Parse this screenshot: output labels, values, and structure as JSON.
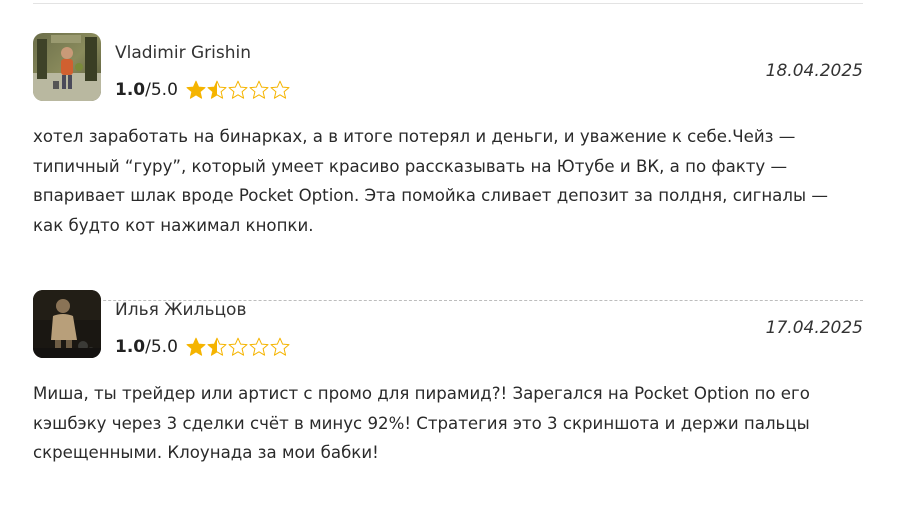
{
  "colors": {
    "star_fill": "#f5b400",
    "star_outline": "#f5b400",
    "divider": "#bdbdbd"
  },
  "reviews": [
    {
      "author": "Vladimir Grishin",
      "avatar_icon": "user-photo-avatar",
      "score": "1.0",
      "score_sep": "/",
      "score_max": "5.0",
      "rating": 1.5,
      "max_stars": 5,
      "date": "18.04.2025",
      "text": "хотел заработать на бинарках, а в итоге потерял и деньги, и уважение к себе.Чейз — типичный “гуру”, который умеет красиво рассказывать на Ютубе и ВК, а по факту — впаривает шлак вроде Pocket Option. Эта помойка сливает депозит за полдня, сигналы — как будто кот нажимал кнопки."
    },
    {
      "author": "Илья Жильцов",
      "avatar_icon": "user-photo-avatar",
      "score": "1.0",
      "score_sep": "/",
      "score_max": "5.0",
      "rating": 1.5,
      "max_stars": 5,
      "date": "17.04.2025",
      "text": "Миша, ты трейдер или артист с промо для пирамид?! Зарегался на Pocket Option по его кэшбэку через 3 сделки счёт в минус 92%! Стратегия это 3 скриншота и держи пальцы скрещенными. Клоунада за мои бабки!"
    }
  ]
}
